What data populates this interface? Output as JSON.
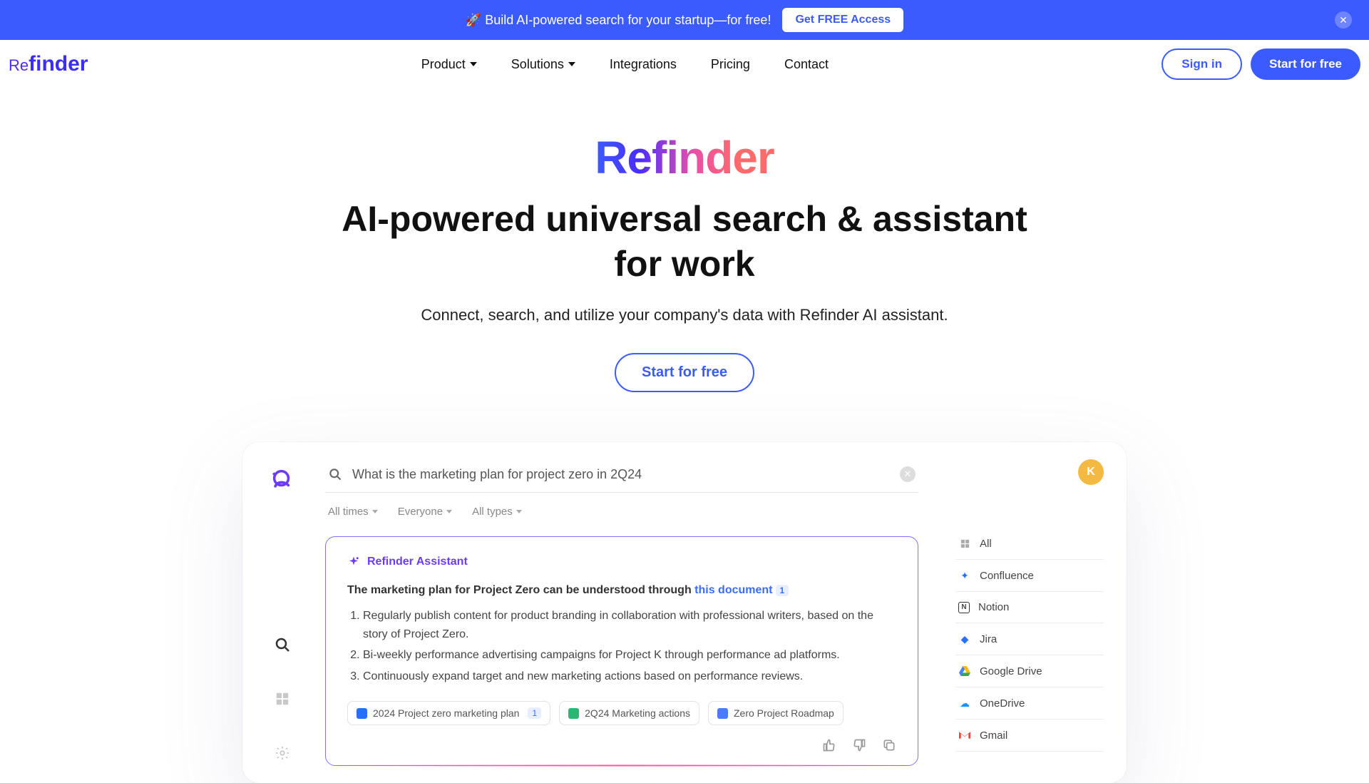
{
  "banner": {
    "text": "🚀 Build AI-powered search for your startup—for free!",
    "cta": "Get FREE Access"
  },
  "nav": {
    "logo_re": "Re",
    "logo_finder": "finder",
    "items": [
      {
        "label": "Product",
        "dropdown": true
      },
      {
        "label": "Solutions",
        "dropdown": true
      },
      {
        "label": "Integrations",
        "dropdown": false
      },
      {
        "label": "Pricing",
        "dropdown": false
      },
      {
        "label": "Contact",
        "dropdown": false
      }
    ],
    "signin": "Sign in",
    "start": "Start for free"
  },
  "hero": {
    "brand": "Refinder",
    "title_l1": "AI-powered universal search & assistant",
    "title_l2": "for work",
    "sub": "Connect, search, and utilize your company's data with Refinder AI assistant.",
    "cta": "Start for free"
  },
  "preview": {
    "search_value": "What is the marketing plan for project zero in 2Q24",
    "filters": [
      "All times",
      "Everyone",
      "All types"
    ],
    "assistant": {
      "title": "Refinder Assistant",
      "lead_prefix": "The marketing plan for Project Zero can be understood through ",
      "lead_link": "this document",
      "lead_badge": "1",
      "points": [
        "Regularly publish content for product branding in collaboration with professional writers, based on the story of Project Zero.",
        "Bi-weekly performance advertising campaigns for Project K through performance ad platforms.",
        "Continuously expand target and new marketing actions based on performance reviews."
      ],
      "chips": [
        {
          "label": "2024 Project zero marketing plan",
          "badge": "1",
          "color": "#2670FF"
        },
        {
          "label": "2Q24 Marketing actions",
          "badge": "",
          "color": "#2BB673"
        },
        {
          "label": "Zero Project Roadmap",
          "badge": "",
          "color": "#4A7BFF"
        }
      ]
    },
    "avatar": "K",
    "sources": [
      {
        "label": "All",
        "icon": "grid",
        "color": "#aaa"
      },
      {
        "label": "Confluence",
        "icon": "confluence",
        "color": "#2670FF"
      },
      {
        "label": "Notion",
        "icon": "notion",
        "color": "#000"
      },
      {
        "label": "Jira",
        "icon": "jira",
        "color": "#2670FF"
      },
      {
        "label": "Google Drive",
        "icon": "gdrive",
        "color": "#3CBA54"
      },
      {
        "label": "OneDrive",
        "icon": "onedrive",
        "color": "#1A91FF"
      },
      {
        "label": "Gmail",
        "icon": "gmail",
        "color": "#E94335"
      }
    ]
  }
}
